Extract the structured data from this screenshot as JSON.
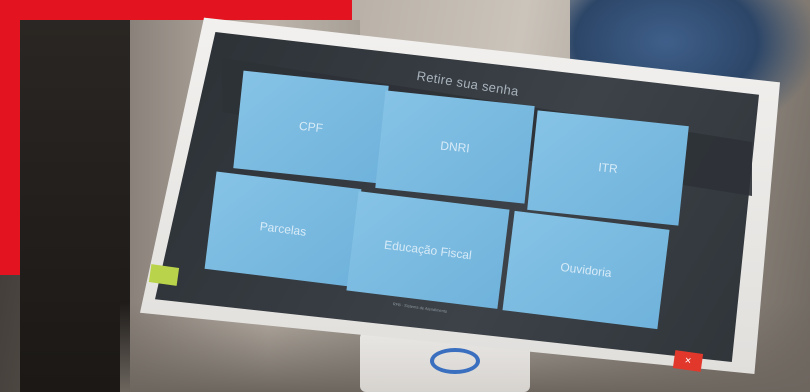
{
  "kiosk": {
    "title": "Retire sua senha",
    "tiles": [
      {
        "label": "CPF"
      },
      {
        "label": "DNRI"
      },
      {
        "label": "ITR"
      },
      {
        "label": "Parcelas"
      },
      {
        "label": "Educação Fiscal"
      },
      {
        "label": "Ouvidoria"
      }
    ],
    "footer": "RFB · Sistema de Atendimento",
    "close_glyph": "×",
    "back_icon": "back-icon",
    "close_icon": "close-icon"
  },
  "colors": {
    "tile": "#7dbde3",
    "back_button": "#b9d34a",
    "close_button": "#e1382b",
    "brand_red": "#e3141f"
  }
}
